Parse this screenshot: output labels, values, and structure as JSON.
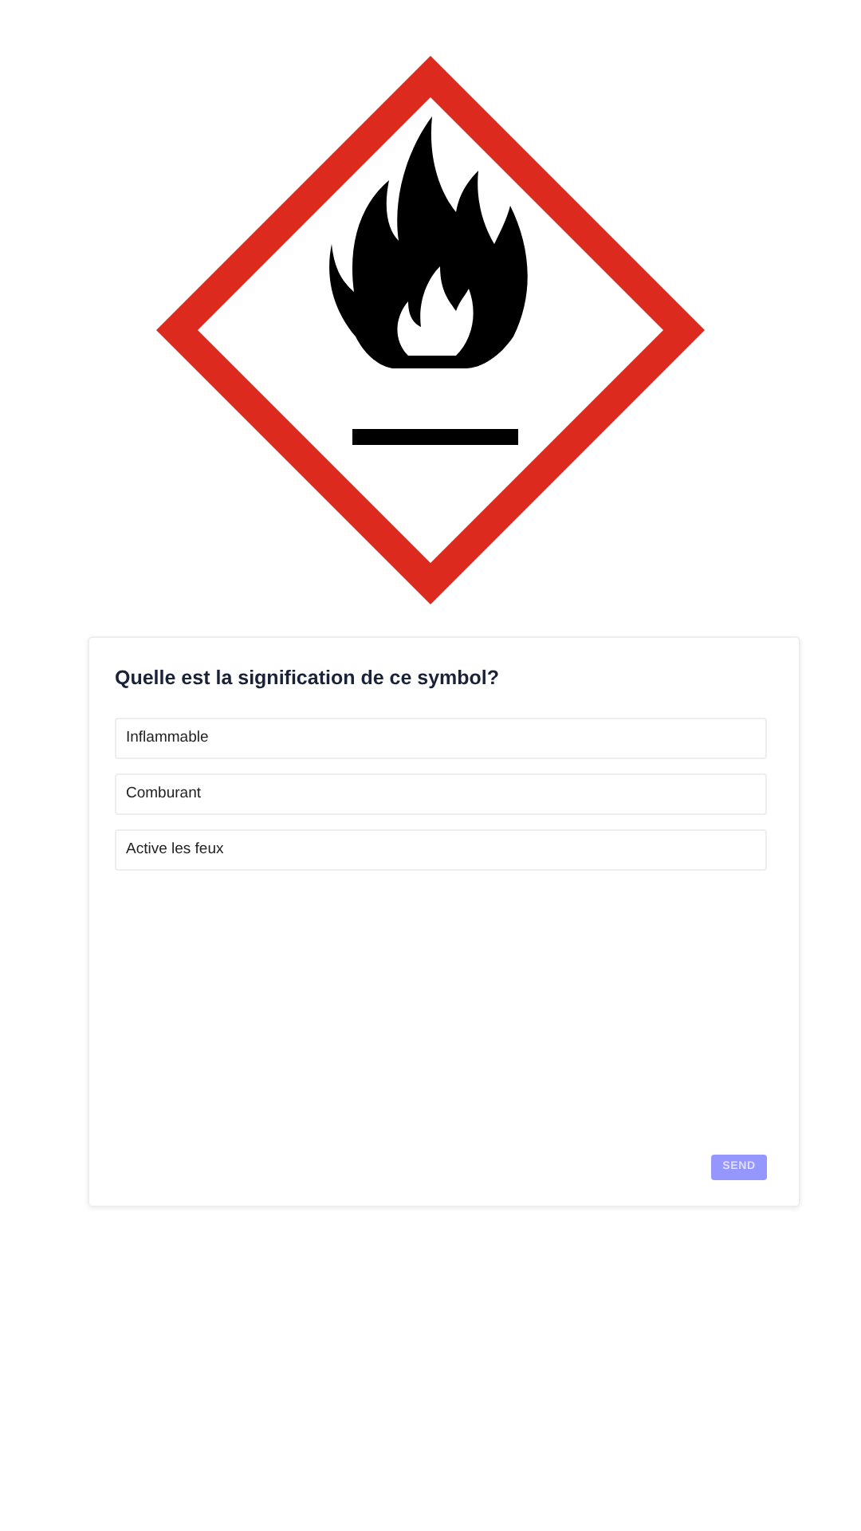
{
  "question": "Quelle est la signification de ce symbol?",
  "options": [
    {
      "label": "Inflammable",
      "selected": false
    },
    {
      "label": "Comburant",
      "selected": false
    },
    {
      "label": "Active les feux",
      "selected": false
    }
  ],
  "send_button": {
    "label": "SEND",
    "disabled": true
  }
}
